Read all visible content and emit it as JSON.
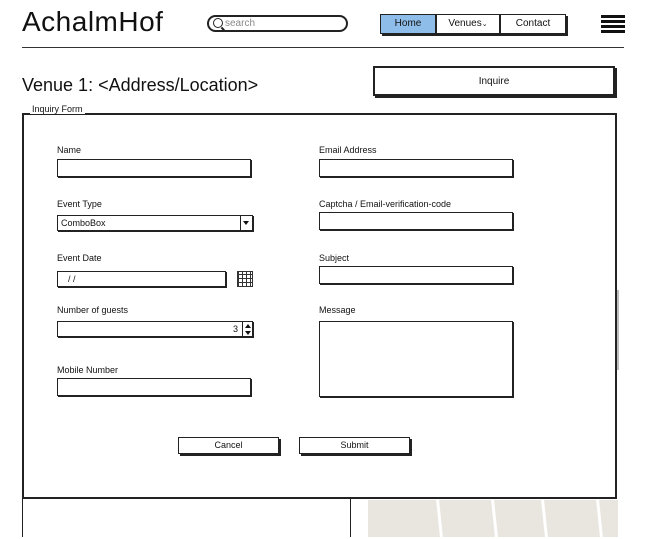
{
  "header": {
    "brand": "AchalmHof",
    "search_placeholder": "search",
    "nav": {
      "home": "Home",
      "venues": "Venues",
      "contact": "Contact"
    }
  },
  "page": {
    "title": "Venue 1: <Address/Location>",
    "inquire_label": "Inquire"
  },
  "form": {
    "legend": "Inquiry Form",
    "name_label": "Name",
    "event_type_label": "Event Type",
    "event_type_value": "ComboBox",
    "event_date_label": "Event Date",
    "event_date_value": "/ /",
    "guests_label": "Number of guests",
    "guests_value": "3",
    "mobile_label": "Mobile Number",
    "email_label": "Email Address",
    "captcha_label": "Captcha / Email-verification-code",
    "subject_label": "Subject",
    "message_label": "Message",
    "cancel_label": "Cancel",
    "submit_label": "Submit"
  },
  "colors": {
    "nav_active": "#8fbde9",
    "image_placeholder": "#e9e6df"
  }
}
